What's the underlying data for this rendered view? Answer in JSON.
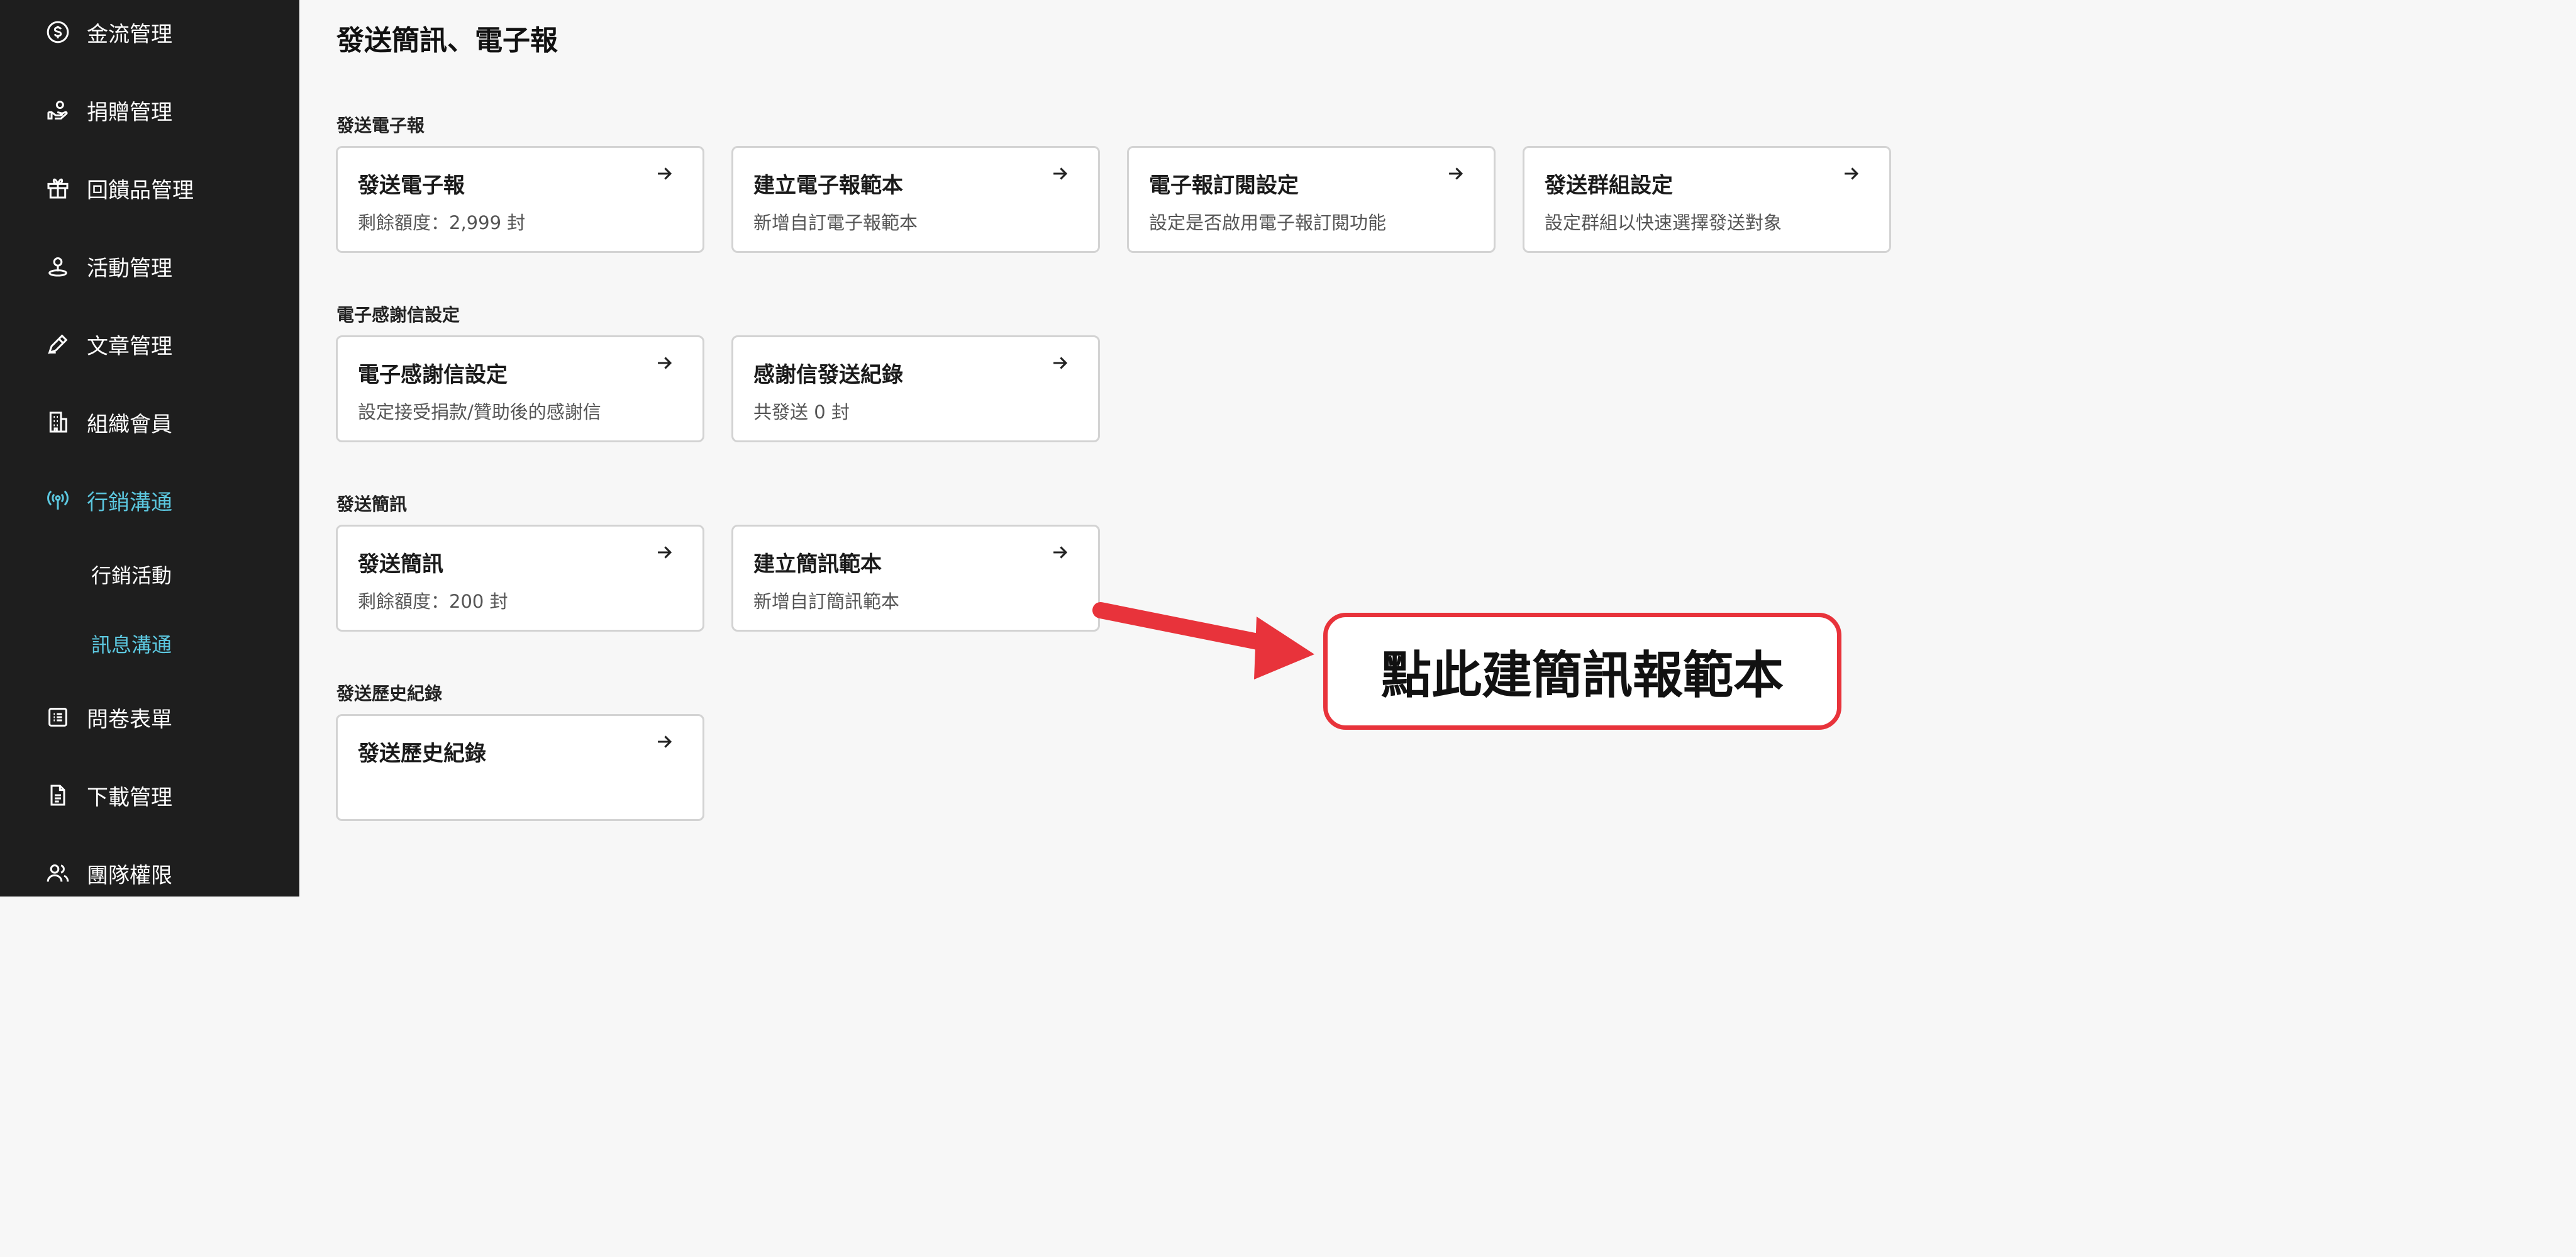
{
  "sidebar": {
    "items": [
      {
        "label": "金流管理",
        "icon": "dollar-circle-icon"
      },
      {
        "label": "捐贈管理",
        "icon": "hand-donate-icon"
      },
      {
        "label": "回饋品管理",
        "icon": "gift-icon"
      },
      {
        "label": "活動管理",
        "icon": "location-pin-icon"
      },
      {
        "label": "文章管理",
        "icon": "pen-icon"
      },
      {
        "label": "組織會員",
        "icon": "building-icon"
      },
      {
        "label": "行銷溝通",
        "icon": "broadcast-icon"
      },
      {
        "label": "問卷表單",
        "icon": "list-icon"
      },
      {
        "label": "下載管理",
        "icon": "document-icon"
      },
      {
        "label": "團隊權限",
        "icon": "users-icon"
      }
    ],
    "sub_items": [
      {
        "label": "行銷活動"
      },
      {
        "label": "訊息溝通"
      }
    ],
    "active_color": "#5cc8e0"
  },
  "page": {
    "title": "發送簡訊、電子報"
  },
  "sections": [
    {
      "label": "發送電子報",
      "cards": [
        {
          "title": "發送電子報",
          "desc": "剩餘額度：2,999 封"
        },
        {
          "title": "建立電子報範本",
          "desc": "新增自訂電子報範本"
        },
        {
          "title": "電子報訂閱設定",
          "desc": "設定是否啟用電子報訂閱功能"
        },
        {
          "title": "發送群組設定",
          "desc": "設定群組以快速選擇發送對象"
        }
      ]
    },
    {
      "label": "電子感謝信設定",
      "cards": [
        {
          "title": "電子感謝信設定",
          "desc": "設定接受捐款/贊助後的感謝信"
        },
        {
          "title": "感謝信發送紀錄",
          "desc": "共發送 0 封"
        }
      ]
    },
    {
      "label": "發送簡訊",
      "cards": [
        {
          "title": "發送簡訊",
          "desc": "剩餘額度：200 封"
        },
        {
          "title": "建立簡訊範本",
          "desc": "新增自訂簡訊範本"
        }
      ]
    },
    {
      "label": "發送歷史紀錄",
      "cards": [
        {
          "title": "發送歷史紀錄",
          "desc": ""
        }
      ]
    }
  ],
  "annotation": {
    "callout_text": "點此建簡訊報範本",
    "color": "#e8333b"
  }
}
